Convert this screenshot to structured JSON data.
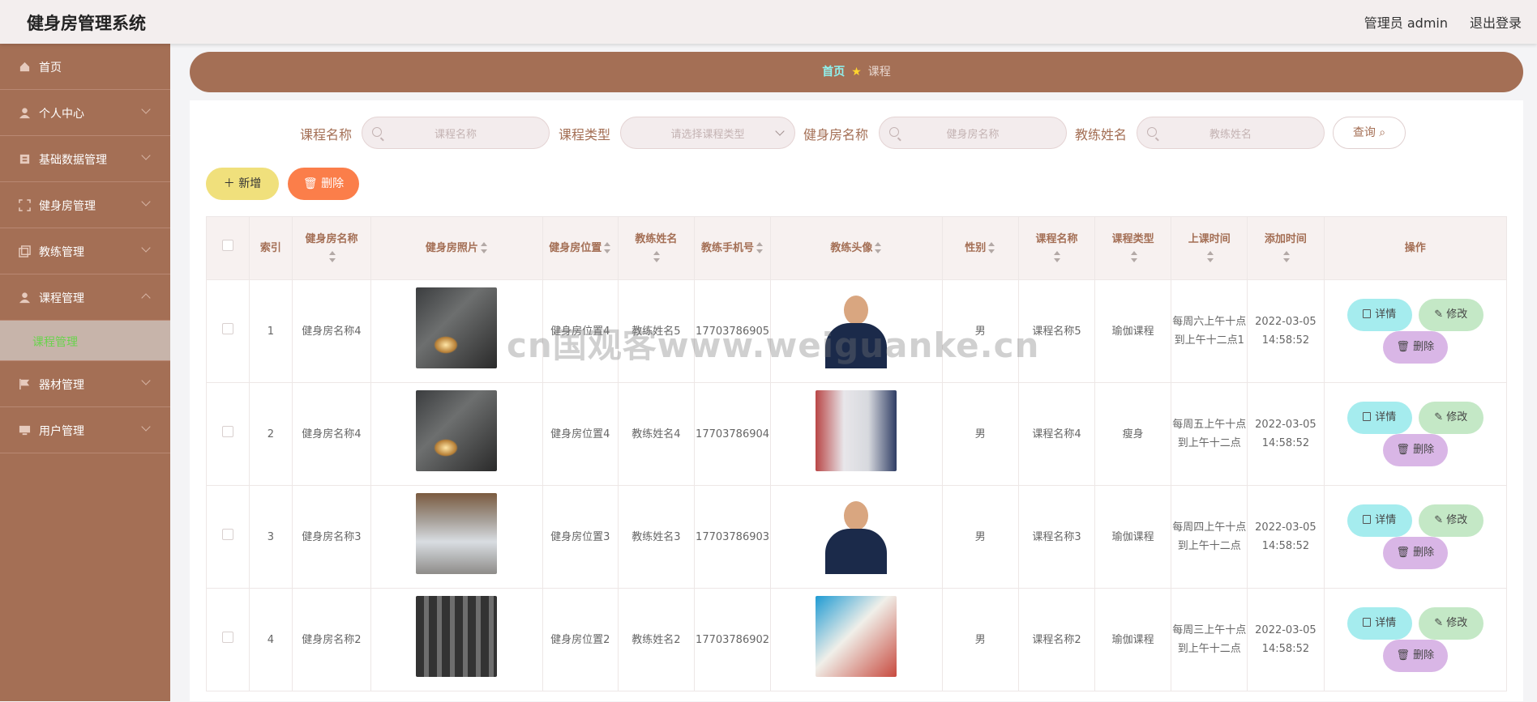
{
  "header": {
    "title": "健身房管理系统",
    "admin": "管理员 admin",
    "logout": "退出登录"
  },
  "sidebar": {
    "items": [
      {
        "label": "首页",
        "icon": "home-icon"
      },
      {
        "label": "个人中心",
        "icon": "user-icon"
      },
      {
        "label": "基础数据管理",
        "icon": "data-icon"
      },
      {
        "label": "健身房管理",
        "icon": "frame-icon"
      },
      {
        "label": "教练管理",
        "icon": "copy-icon"
      },
      {
        "label": "课程管理",
        "icon": "user-icon",
        "expanded": true
      },
      {
        "label": "器材管理",
        "icon": "flag-icon"
      },
      {
        "label": "用户管理",
        "icon": "monitor-icon"
      }
    ],
    "active_sub": "课程管理"
  },
  "breadcrumb": {
    "home": "首页",
    "current": "课程"
  },
  "search": {
    "course_name_label": "课程名称",
    "course_name_ph": "课程名称",
    "course_type_label": "课程类型",
    "course_type_ph": "请选择课程类型",
    "gym_name_label": "健身房名称",
    "gym_name_ph": "健身房名称",
    "coach_name_label": "教练姓名",
    "coach_name_ph": "教练姓名",
    "query": "查询"
  },
  "actions": {
    "add": "新增",
    "delete": "删除"
  },
  "table": {
    "headers": [
      "索引",
      "健身房名称",
      "健身房照片",
      "健身房位置",
      "教练姓名",
      "教练手机号",
      "教练头像",
      "性别",
      "课程名称",
      "课程类型",
      "上课时间",
      "添加时间",
      "操作"
    ],
    "rows": [
      {
        "index": "1",
        "gym": "健身房名称4",
        "loc": "健身房位置4",
        "coach": "教练姓名5",
        "phone": "17703786905",
        "gender": "男",
        "course": "课程名称5",
        "type": "瑜伽课程",
        "time": "每周六上午十点到上午十二点1",
        "added": "2022-03-05 14:58:52"
      },
      {
        "index": "2",
        "gym": "健身房名称4",
        "loc": "健身房位置4",
        "coach": "教练姓名4",
        "phone": "17703786904",
        "gender": "男",
        "course": "课程名称4",
        "type": "瘦身",
        "time": "每周五上午十点到上午十二点",
        "added": "2022-03-05 14:58:52"
      },
      {
        "index": "3",
        "gym": "健身房名称3",
        "loc": "健身房位置3",
        "coach": "教练姓名3",
        "phone": "17703786903",
        "gender": "男",
        "course": "课程名称3",
        "type": "瑜伽课程",
        "time": "每周四上午十点到上午十二点",
        "added": "2022-03-05 14:58:52"
      },
      {
        "index": "4",
        "gym": "健身房名称2",
        "loc": "健身房位置2",
        "coach": "教练姓名2",
        "phone": "17703786902",
        "gender": "男",
        "course": "课程名称2",
        "type": "瑜伽课程",
        "time": "每周三上午十点到上午十二点",
        "added": "2022-03-05 14:58:52"
      }
    ],
    "op_detail": "详情",
    "op_edit": "修改",
    "op_delete": "删除"
  },
  "watermark": "cn国观客www.weiguanke.cn"
}
